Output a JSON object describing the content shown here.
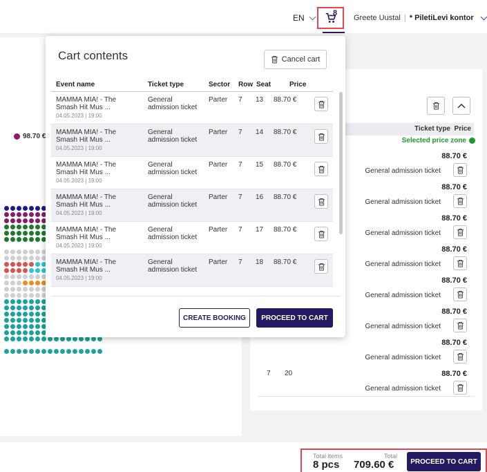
{
  "header": {
    "language": "EN",
    "cart_count": "8",
    "user_name": "Greete Uustal",
    "separator": "|",
    "organization": "* PiletiLevi kontor"
  },
  "legend": {
    "price": "98.70 €"
  },
  "right_panel": {
    "col_ticket_type": "Ticket type",
    "col_price": "Price",
    "price_zone_label": "Selected price zone",
    "rows": [
      {
        "row": "",
        "seat": "",
        "price": "88.70 €",
        "type": "General admission ticket"
      },
      {
        "row": "",
        "seat": "",
        "price": "88.70 €",
        "type": "General admission ticket"
      },
      {
        "row": "",
        "seat": "",
        "price": "88.70 €",
        "type": "General admission ticket"
      },
      {
        "row": "",
        "seat": "",
        "price": "88.70 €",
        "type": "General admission ticket"
      },
      {
        "row": "",
        "seat": "",
        "price": "88.70 €",
        "type": "General admission ticket"
      },
      {
        "row": "",
        "seat": "",
        "price": "88.70 €",
        "type": "General admission ticket"
      },
      {
        "row": "",
        "seat": "",
        "price": "88.70 €",
        "type": "General admission ticket"
      },
      {
        "row": "7",
        "seat": "20",
        "price": "88.70 €",
        "type": "General admission ticket"
      }
    ]
  },
  "popup": {
    "title": "Cart contents",
    "cancel_label": "Cancel cart",
    "columns": {
      "event": "Event name",
      "type": "Ticket type",
      "sector": "Sector",
      "row": "Row",
      "seat": "Seat",
      "price": "Price"
    },
    "rows": [
      {
        "event": "MAMMA MIA! - The Smash Hit Mus ...",
        "date": "04.05.2023 | 19:00",
        "type": "General admission ticket",
        "sector": "Parter",
        "row": "7",
        "seat": "13",
        "price": "88.70 €"
      },
      {
        "event": "MAMMA MIA! - The Smash Hit Mus ...",
        "date": "04.05.2023 | 19:00",
        "type": "General admission ticket",
        "sector": "Parter",
        "row": "7",
        "seat": "14",
        "price": "88.70 €"
      },
      {
        "event": "MAMMA MIA! - The Smash Hit Mus ...",
        "date": "04.05.2023 | 19:00",
        "type": "General admission ticket",
        "sector": "Parter",
        "row": "7",
        "seat": "15",
        "price": "88.70 €"
      },
      {
        "event": "MAMMA MIA! - The Smash Hit Mus ...",
        "date": "04.05.2023 | 19:00",
        "type": "General admission ticket",
        "sector": "Parter",
        "row": "7",
        "seat": "16",
        "price": "88.70 €"
      },
      {
        "event": "MAMMA MIA! - The Smash Hit Mus ...",
        "date": "04.05.2023 | 19:00",
        "type": "General admission ticket",
        "sector": "Parter",
        "row": "7",
        "seat": "17",
        "price": "88.70 €"
      },
      {
        "event": "MAMMA MIA! - The Smash Hit Mus ...",
        "date": "04.05.2023 | 19:00",
        "type": "General admission ticket",
        "sector": "Parter",
        "row": "7",
        "seat": "18",
        "price": "88.70 €"
      }
    ],
    "create_booking_label": "CREATE BOOKING",
    "proceed_label": "PROCEED TO CART"
  },
  "footer": {
    "total_items_label": "Total items",
    "total_items_value": "8 pcs",
    "total_label": "Total",
    "total_value": "709.60 €",
    "proceed_label": "PROCEED TO CART"
  },
  "colors": {
    "brand": "#231a61",
    "highlight": "#e2474d",
    "zone_green": "#1d9a2c"
  }
}
